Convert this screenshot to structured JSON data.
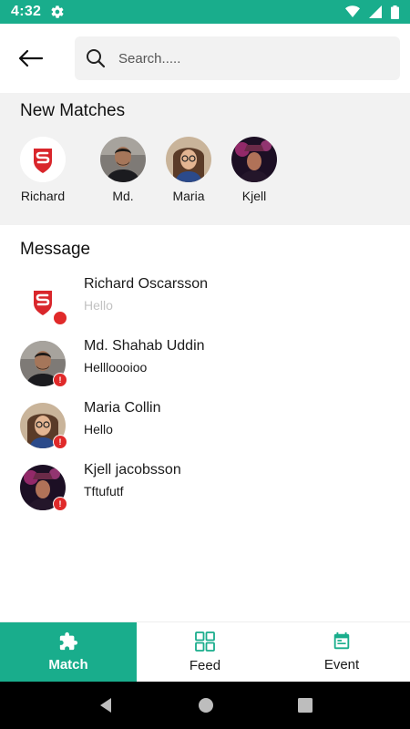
{
  "status_bar": {
    "time": "4:32",
    "bg_color": "#19ad8c"
  },
  "search": {
    "placeholder": "Search....."
  },
  "matches": {
    "title": "New Matches",
    "items": [
      {
        "name": "Richard",
        "avatar": "shield-logo"
      },
      {
        "name": "Md.",
        "avatar": "photo"
      },
      {
        "name": "Maria",
        "avatar": "photo"
      },
      {
        "name": "Kjell",
        "avatar": "photo"
      }
    ]
  },
  "messages": {
    "title": "Message",
    "items": [
      {
        "name": "Richard Oscarsson",
        "text": "Hello",
        "badge": "",
        "text_muted": true
      },
      {
        "name": "Md. Shahab Uddin",
        "text": "Hellloooioo",
        "badge": "!",
        "text_muted": false
      },
      {
        "name": "Maria Collin",
        "text": "Hello",
        "badge": "!",
        "text_muted": false
      },
      {
        "name": "Kjell jacobsson",
        "text": "Tftufutf",
        "badge": "!",
        "text_muted": false
      }
    ]
  },
  "bottom_nav": {
    "items": [
      {
        "label": "Match",
        "icon": "puzzle-icon",
        "active": true
      },
      {
        "label": "Feed",
        "icon": "grid-icon",
        "active": false
      },
      {
        "label": "Event",
        "icon": "calendar-icon",
        "active": false
      }
    ]
  },
  "colors": {
    "accent": "#19ad8c",
    "badge": "#e02a2a",
    "brand_red": "#d9262b"
  }
}
